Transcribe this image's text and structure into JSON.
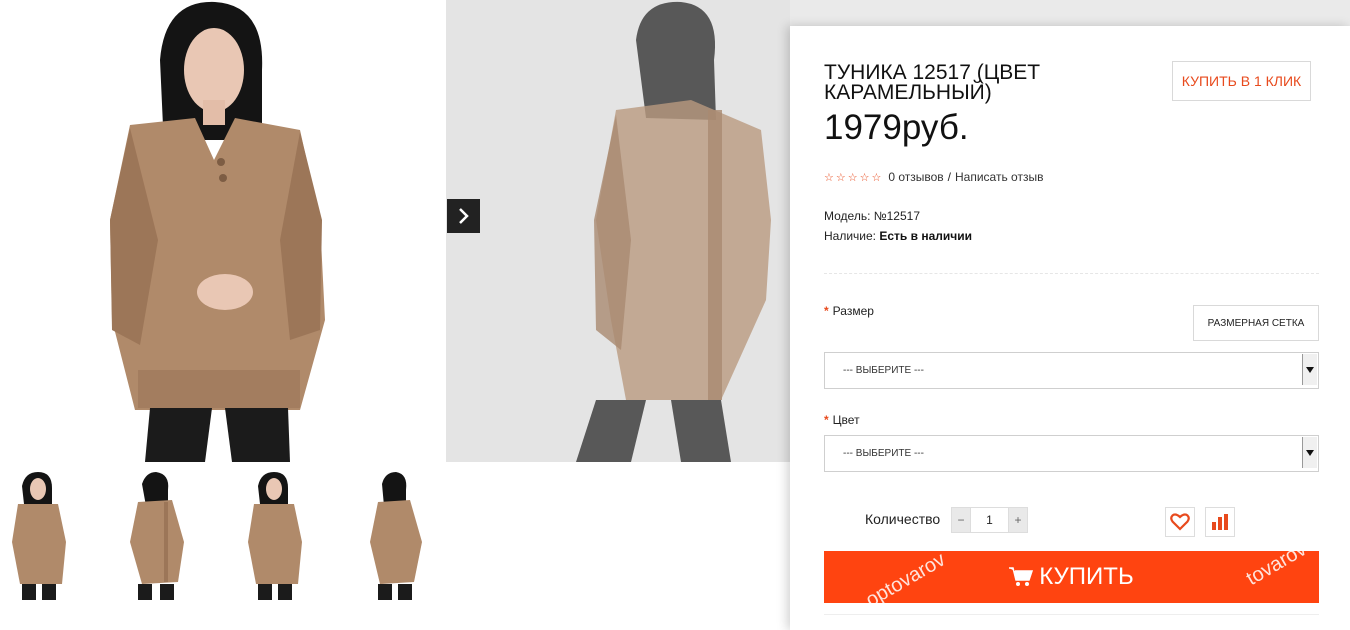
{
  "product": {
    "title": "ТУНИКА 12517 (ЦВЕТ КАРАМЕЛЬНЫЙ)",
    "price": "1979руб.",
    "one_click_label": "КУПИТЬ В 1 КЛИК",
    "rating": {
      "stars": "☆☆☆☆☆",
      "stars_filled": 0,
      "stars_total": 5,
      "reviews_link": "0 отзывов",
      "separator": "/",
      "write_review_link": "Написать отзыв"
    },
    "model_label": "Модель:",
    "model_value": "№12517",
    "availability_label": "Наличие:",
    "availability_value": "Есть в наличии"
  },
  "options": {
    "required_mark": "*",
    "size": {
      "label": "Размер",
      "selected": "--- ВЫБЕРИТЕ ---"
    },
    "size_grid_label": "РАЗМЕРНАЯ СЕТКА",
    "color": {
      "label": "Цвет",
      "selected": "--- ВЫБЕРИТЕ ---"
    }
  },
  "quantity": {
    "label": "Количество",
    "value": "1",
    "minus": "−",
    "plus": "+"
  },
  "buy": {
    "label": "КУПИТЬ",
    "watermark_left": "optovarov",
    "watermark_right": "tovarov"
  },
  "gallery": {
    "thumb_count": 4,
    "colors": {
      "sweater": "#b08a6a",
      "sweater_dark": "#9c7658",
      "hair": "#141414",
      "leggings": "#1b1b1b",
      "skin": "#e9c7b4"
    }
  },
  "colors": {
    "accent": "#ff4410",
    "link_red": "#e84a1d"
  }
}
